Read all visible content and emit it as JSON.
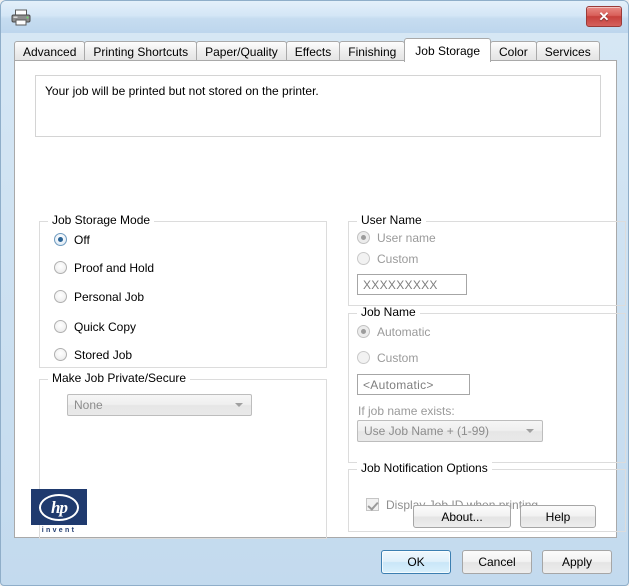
{
  "window": {
    "icon": "printer-icon",
    "close_label": "✕"
  },
  "tabs": [
    {
      "label": "Advanced",
      "active": false
    },
    {
      "label": "Printing Shortcuts",
      "active": false
    },
    {
      "label": "Paper/Quality",
      "active": false
    },
    {
      "label": "Effects",
      "active": false
    },
    {
      "label": "Finishing",
      "active": false
    },
    {
      "label": "Job Storage",
      "active": true
    },
    {
      "label": "Color",
      "active": false
    },
    {
      "label": "Services",
      "active": false
    }
  ],
  "status": {
    "message": "Your job will be printed but not stored on the printer."
  },
  "job_storage_mode": {
    "legend": "Job Storage Mode",
    "options": [
      {
        "label": "Off",
        "checked": true
      },
      {
        "label": "Proof and Hold",
        "checked": false
      },
      {
        "label": "Personal Job",
        "checked": false
      },
      {
        "label": "Quick Copy",
        "checked": false
      },
      {
        "label": "Stored Job",
        "checked": false
      }
    ]
  },
  "make_private": {
    "legend": "Make Job Private/Secure",
    "dropdown_value": "None"
  },
  "user_name": {
    "legend": "User Name",
    "options": [
      {
        "label": "User name",
        "checked": true
      },
      {
        "label": "Custom",
        "checked": false
      }
    ],
    "custom_value": "XXXXXXXXX"
  },
  "job_name": {
    "legend": "Job Name",
    "options": [
      {
        "label": "Automatic",
        "checked": true
      },
      {
        "label": "Custom",
        "checked": false
      }
    ],
    "custom_value": "<Automatic>",
    "if_exists_label": "If job name exists:",
    "if_exists_value": "Use Job Name + (1-99)"
  },
  "job_notification": {
    "legend": "Job Notification Options",
    "checkbox_label": "Display Job ID when printing",
    "checkbox_checked": true
  },
  "logo": {
    "letters": "hp",
    "tagline": "invent"
  },
  "buttons": {
    "about": "About...",
    "help": "Help",
    "ok": "OK",
    "cancel": "Cancel",
    "apply": "Apply"
  },
  "colors": {
    "title_bar": "#cfe2f2",
    "close_red": "#c7403c",
    "hp_blue": "#1f3a6e",
    "radio_dot": "#2a6496",
    "default_button_border": "#3c7fb1"
  }
}
